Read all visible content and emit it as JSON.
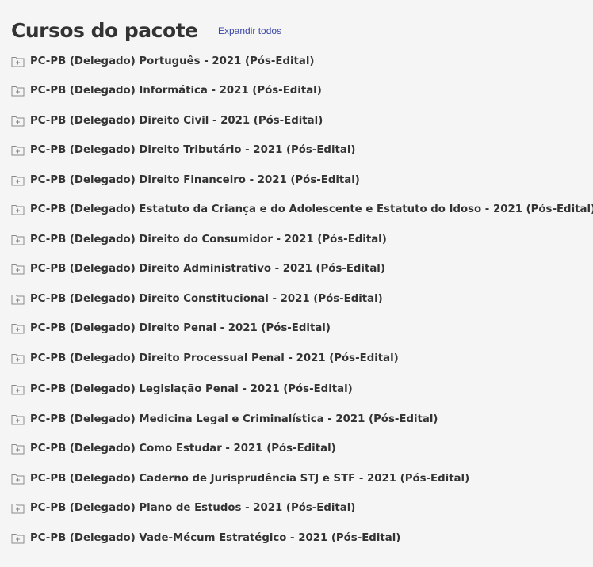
{
  "header": {
    "title": "Cursos do pacote",
    "expand_all_label": "Expandir todos"
  },
  "courses": [
    {
      "label": "PC-PB (Delegado) Português - 2021 (Pós-Edital)",
      "icon": "folder-plus-icon"
    },
    {
      "label": "PC-PB (Delegado) Informática - 2021 (Pós-Edital)",
      "icon": "folder-plus-icon"
    },
    {
      "label": "PC-PB (Delegado) Direito Civil - 2021 (Pós-Edital)",
      "icon": "folder-plus-icon"
    },
    {
      "label": "PC-PB (Delegado) Direito Tributário - 2021 (Pós-Edital)",
      "icon": "folder-plus-icon"
    },
    {
      "label": "PC-PB (Delegado) Direito Financeiro - 2021 (Pós-Edital)",
      "icon": "folder-plus-icon"
    },
    {
      "label": "PC-PB (Delegado) Estatuto da Criança e do Adolescente e Estatuto do Idoso - 2021 (Pós-Edital)",
      "icon": "folder-plus-icon"
    },
    {
      "label": "PC-PB (Delegado) Direito do Consumidor - 2021 (Pós-Edital)",
      "icon": "folder-plus-icon"
    },
    {
      "label": "PC-PB (Delegado) Direito Administrativo - 2021 (Pós-Edital)",
      "icon": "folder-plus-icon"
    },
    {
      "label": "PC-PB (Delegado) Direito Constitucional - 2021 (Pós-Edital)",
      "icon": "folder-plus-icon"
    },
    {
      "label": "PC-PB (Delegado) Direito Penal - 2021 (Pós-Edital)",
      "icon": "folder-plus-icon"
    },
    {
      "label": "PC-PB (Delegado) Direito Processual Penal - 2021 (Pós-Edital)",
      "icon": "folder-plus-icon"
    },
    {
      "label": "PC-PB (Delegado) Legislação Penal - 2021 (Pós-Edital)",
      "icon": "folder-plus-icon"
    },
    {
      "label": "PC-PB (Delegado) Medicina Legal e Criminalística - 2021 (Pós-Edital)",
      "icon": "folder-plus-icon"
    },
    {
      "label": "PC-PB (Delegado) Como Estudar - 2021 (Pós-Edital)",
      "icon": "folder-plus-icon"
    },
    {
      "label": "PC-PB (Delegado) Caderno de Jurisprudência STJ e STF - 2021 (Pós-Edital)",
      "icon": "folder-plus-icon"
    },
    {
      "label": "PC-PB (Delegado) Plano de Estudos - 2021 (Pós-Edital)",
      "icon": "folder-plus-icon"
    },
    {
      "label": "PC-PB (Delegado) Vade-Mécum Estratégico - 2021 (Pós-Edital)",
      "icon": "folder-plus-icon"
    }
  ],
  "colors": {
    "background": "#f5f5f5",
    "text": "#333333",
    "link": "#3b48a8",
    "icon": "#8a8a8a"
  }
}
